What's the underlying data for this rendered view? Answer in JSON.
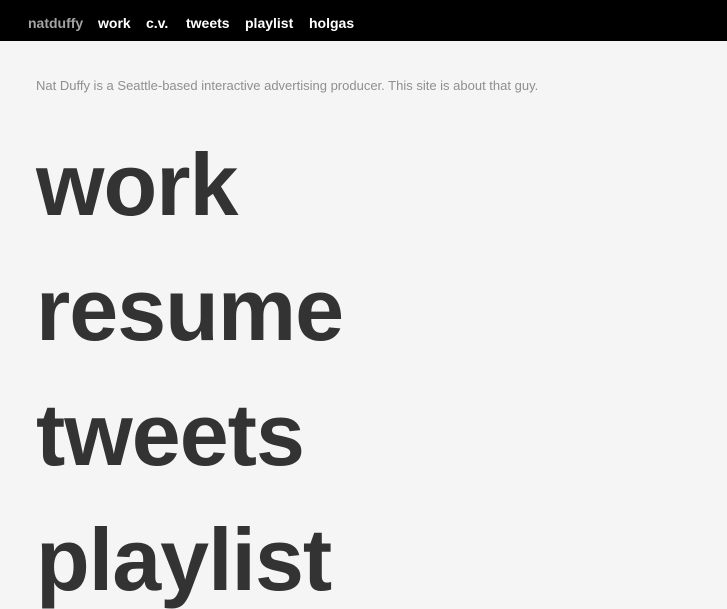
{
  "nav": {
    "brand": "natduffy",
    "items": [
      {
        "label": "work"
      },
      {
        "label": "c.v."
      },
      {
        "label": "tweets"
      },
      {
        "label": "playlist"
      },
      {
        "label": "holgas"
      }
    ]
  },
  "intro": "Nat Duffy is a Seattle-based interactive advertising producer. This site is about that guy.",
  "sections": [
    {
      "label": "work"
    },
    {
      "label": "resume"
    },
    {
      "label": "tweets"
    },
    {
      "label": "playlist"
    }
  ],
  "colors": {
    "nav_background": "#000000",
    "nav_text": "#ffffff",
    "brand_text": "#a3a3a3",
    "page_background": "#f5f5f5",
    "intro_text": "#8f8f8f",
    "big_link_text": "#333333"
  }
}
